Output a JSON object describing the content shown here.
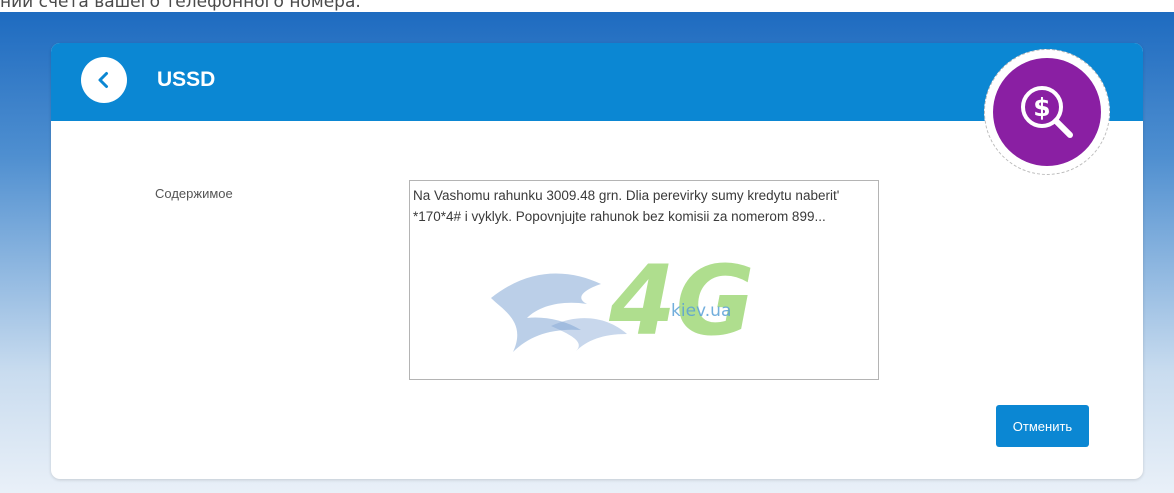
{
  "page": {
    "top_caption": "нии счета вашего телефонного номера."
  },
  "header": {
    "title": "USSD",
    "back_icon": "chevron-left-icon",
    "accent_color": "#0b87d3"
  },
  "promo_icon": {
    "icon": "dollar-magnifier-icon",
    "color": "#8a1fa3"
  },
  "form": {
    "content_label": "Содержимое",
    "content_text": "Na Vashomu rahunku 3009.48 grn. Dlia perevirky sumy kredytu naberit' *170*4# i vyklyk. Popovnjujte rahunok bez komisii za nomerom 899..."
  },
  "watermark": {
    "logo_text": "4G",
    "domain_text": "kiev.ua"
  },
  "actions": {
    "cancel_label": "Отменить"
  }
}
